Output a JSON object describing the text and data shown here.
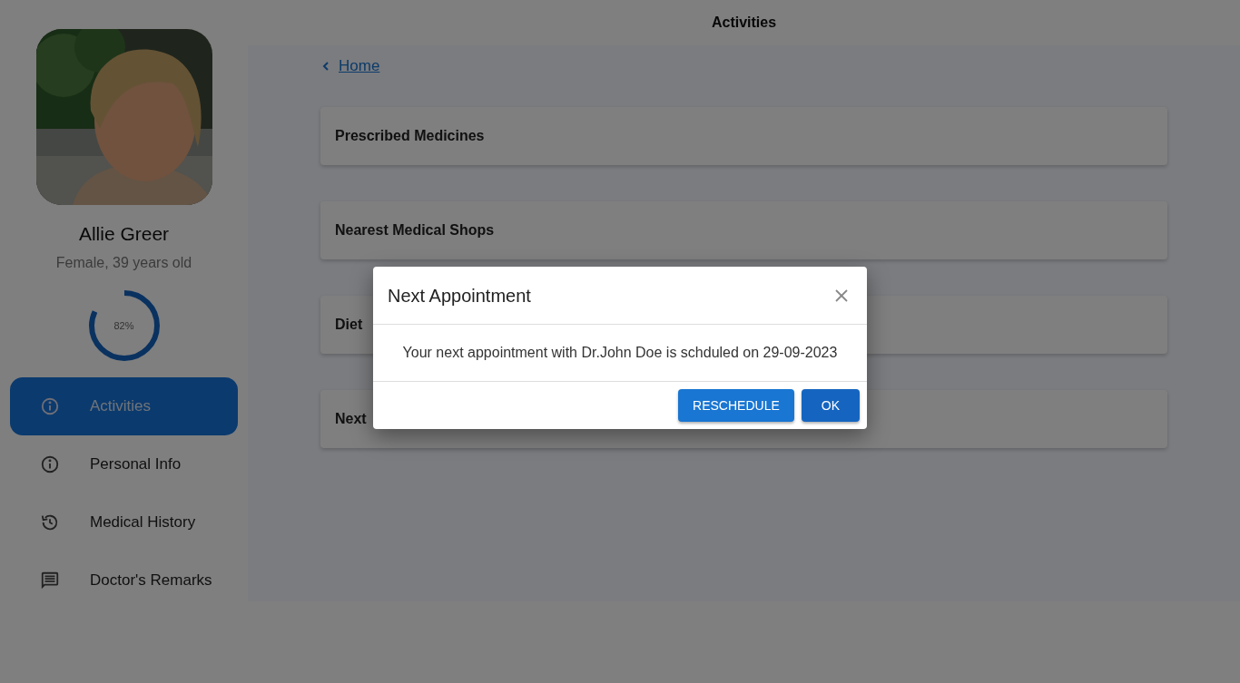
{
  "header": {
    "title": "Activities"
  },
  "profile": {
    "name": "Allie Greer",
    "details": "Female, 39 years old",
    "progress": {
      "level": 0.82,
      "reading": "82%"
    }
  },
  "sidebar": {
    "items": [
      {
        "label": "Activities",
        "kind": "info",
        "selected": true
      },
      {
        "label": "Personal Info",
        "kind": "info",
        "selected": false
      },
      {
        "label": "Medical History",
        "kind": "history",
        "selected": false
      },
      {
        "label": "Doctor's Remarks",
        "kind": "comment",
        "selected": false
      }
    ]
  },
  "breadcrumb": {
    "link": "Home"
  },
  "cards": [
    {
      "title": "Prescribed Medicines"
    },
    {
      "title": "Nearest Medical Shops"
    },
    {
      "title": "Diet"
    },
    {
      "title": "Next"
    }
  ],
  "dialog": {
    "title": "Next Appointment",
    "message": "Your next appointment with Dr.John Doe is schduled on 29-09-2023",
    "buttons": [
      {
        "label": "RESCHEDULE",
        "kind": "secondary"
      },
      {
        "label": "OK",
        "kind": "primary"
      }
    ]
  }
}
